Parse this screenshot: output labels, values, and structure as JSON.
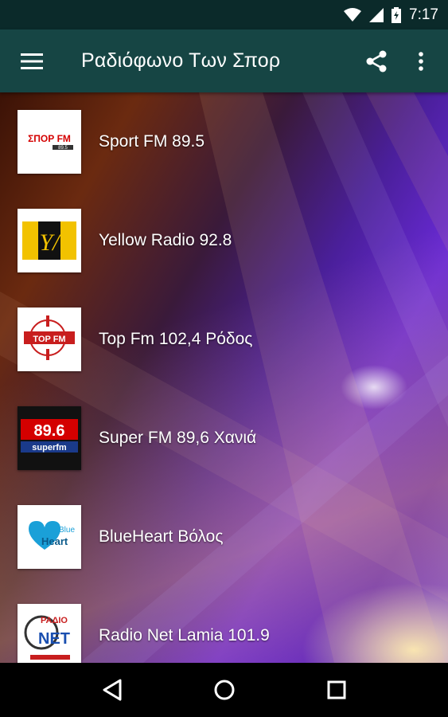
{
  "status_bar": {
    "time": "7:17",
    "icons": [
      "wifi-icon",
      "signal-icon",
      "battery-icon"
    ]
  },
  "app_bar": {
    "title": "Ραδιόφωνο Των Σπορ",
    "menu_icon": "hamburger-menu-icon",
    "share_icon": "share-icon",
    "more_icon": "more-vertical-icon"
  },
  "stations": [
    {
      "name": "Sport FM 89.5",
      "logo_text": "ΣΠΟΡ FM",
      "logo_sub": "89.5",
      "logo_color": "#d40000"
    },
    {
      "name": "Yellow Radio 92.8",
      "logo_text": "Y/",
      "logo_sub": "",
      "logo_color": "#f2c200"
    },
    {
      "name": "Top Fm 102,4 Ρόδος",
      "logo_text": "TOP FM",
      "logo_sub": "",
      "logo_color": "#c81e1e"
    },
    {
      "name": "Super FM 89,6 Χανιά",
      "logo_text": "89.6",
      "logo_sub": "superfm",
      "logo_color": "#d40000"
    },
    {
      "name": "BlueHeart Βόλος",
      "logo_text": "Blue",
      "logo_sub": "Heart",
      "logo_color": "#1aa0d8"
    },
    {
      "name": "Radio Net Lamia 101.9",
      "logo_text": "ΡΑΔΙΟ",
      "logo_sub": "NET",
      "logo_color": "#1a4fb0"
    }
  ],
  "nav_bar": {
    "back_icon": "back-triangle-icon",
    "home_icon": "home-circle-icon",
    "recents_icon": "recents-square-icon"
  },
  "colors": {
    "status_bar": "#0b2a2a",
    "app_bar": "#164544",
    "nav_bar": "#000000"
  }
}
